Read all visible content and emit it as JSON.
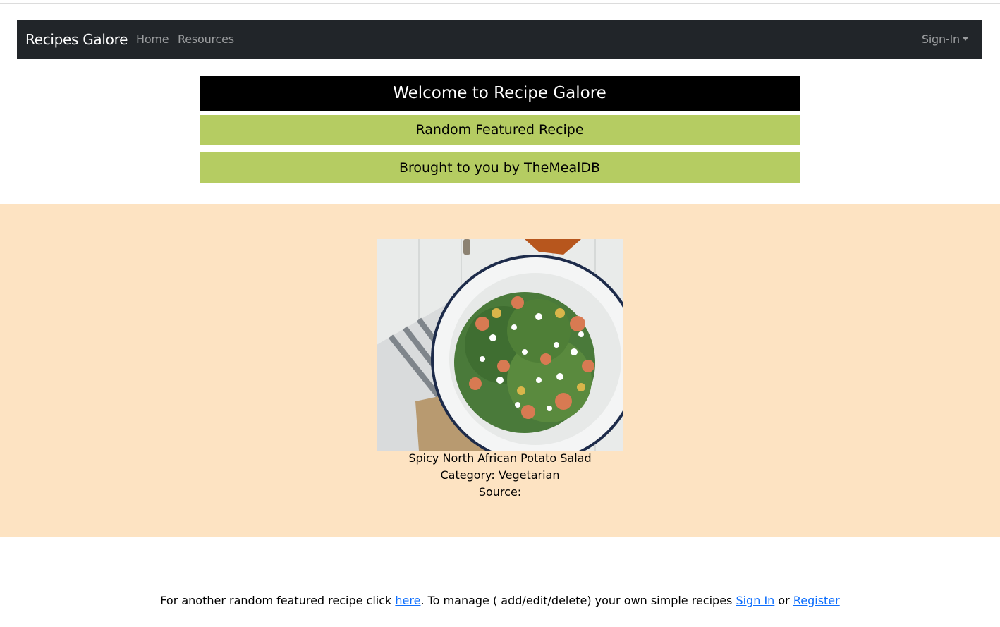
{
  "navbar": {
    "brand": "Recipes Galore",
    "links": [
      {
        "label": "Home"
      },
      {
        "label": "Resources"
      }
    ],
    "signin_label": "Sign-In"
  },
  "banners": {
    "welcome": "Welcome to Recipe Galore",
    "featured": "Random Featured Recipe",
    "credit": "Brought to you by TheMealDB"
  },
  "recipe": {
    "name": "Spicy North African Potato Salad",
    "category": "Category: Vegetarian",
    "source": "Source:"
  },
  "footer": {
    "prefix": "For another random featured recipe click ",
    "here_link": "here",
    "middle": ". To manage ( add/edit/delete) your own simple recipes ",
    "signin_link": "Sign In",
    "or": " or ",
    "register_link": "Register"
  },
  "colors": {
    "navbar_bg": "#212529",
    "banner_black": "#000000",
    "banner_green": "#b5cc62",
    "featured_bg": "#fde3c2",
    "link": "#0d6efd"
  }
}
